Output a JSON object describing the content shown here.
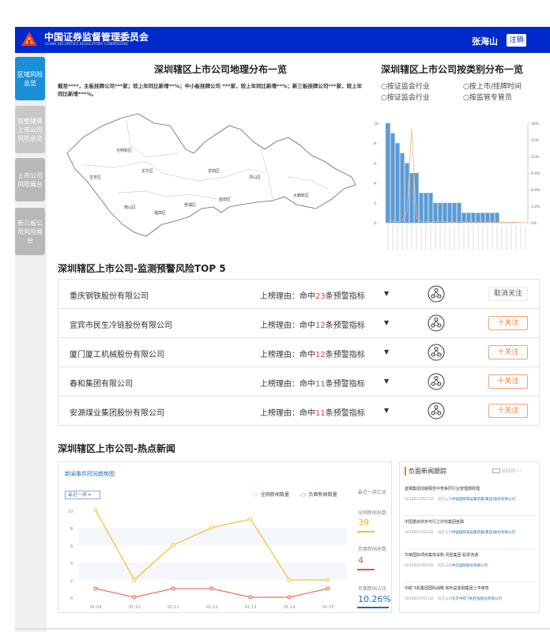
{
  "header": {
    "org_cn": "中国证券监督管理委员会",
    "org_en": "CHINA SECURITIES REGULATORY COMMISSION",
    "username": "张海山",
    "logout": "注销"
  },
  "sidebar": {
    "items": [
      {
        "label": "区域风险总览",
        "active": true
      },
      {
        "label": "监管辖属上市公司风险总览",
        "active": false
      },
      {
        "label": "上市公司风险展台",
        "active": false
      },
      {
        "label": "新三板公司风险展台",
        "active": false
      }
    ]
  },
  "geo": {
    "title": "深圳辖区上市公司地理分布一览",
    "note": "截至****，主板挂牌公司***家；较上年同比新增**%；中小板挂牌公司 ***家，较上年同比新增**%；新三板挂牌公司***家，较上年同比新增***%。",
    "districts": [
      "光明新区",
      "宝安区",
      "龙华区",
      "龙岗区",
      "坪山区",
      "大鹏新区",
      "南山区",
      "福田区",
      "罗湖区",
      "盐田区"
    ]
  },
  "category": {
    "title": "深圳辖区上市公司按类别分布一览",
    "options": [
      "按证监会行业",
      "按上市/挂牌时间",
      "按证监会行业",
      "按监管专管员"
    ]
  },
  "chart_data": {
    "type": "bar",
    "bar_values": [
      10,
      9,
      8,
      7,
      6,
      5,
      5,
      3,
      3,
      3,
      2,
      2,
      2,
      2,
      2,
      2,
      1,
      1,
      1,
      1,
      1,
      1,
      1,
      1,
      0,
      0,
      0,
      0,
      0,
      0
    ],
    "line_values": [
      0.5,
      0.3,
      0.2,
      0.5,
      2,
      17,
      0.8,
      0.3,
      0.2,
      0.1,
      0.2,
      0.3,
      0.2,
      0.1,
      0.1,
      0.2,
      0.1,
      0.1,
      0.1,
      0.1,
      0.1,
      0.1,
      0.1,
      0.1,
      0.1,
      0.1,
      0.1,
      0.1,
      0,
      0
    ],
    "ylim_left": [
      0,
      10
    ],
    "ylim_right": [
      0,
      18
    ],
    "yticks_left": [
      "10 -",
      "8 -",
      "6 -",
      "4 -",
      "2 -",
      "0 -"
    ],
    "yticks_right": [
      "- 18%",
      "- 15%",
      "- 12%",
      "- 9.0%",
      "- 6.0%",
      "- 3.0%",
      "- 0%"
    ],
    "bar_color": "#5b9bd5",
    "line_color": "#f4b183"
  },
  "top5": {
    "title": "深圳辖区上市公司-监测预警风险TOP 5",
    "reason_prefix": "上榜理由：命中",
    "reason_suffix": "条预警指标",
    "rows": [
      {
        "name": "重庆钢铁股份有限公司",
        "count": "23",
        "action": "取消关注"
      },
      {
        "name": "宜宾市民生冷链股份有限公司",
        "count": "12",
        "action": "十关注"
      },
      {
        "name": "厦门厦工机械股份有限公司",
        "count": "12",
        "action": "十关注"
      },
      {
        "name": "春和集团有限公司",
        "count": "11",
        "action": "十关注"
      },
      {
        "name": "安源煤业集团股份有限公司",
        "count": "11",
        "action": "十关注"
      }
    ]
  },
  "news": {
    "title": "深圳辖区上市公司-热点新闻",
    "trend": {
      "title": "新闻事件时间趋势图",
      "select": "最近一周",
      "legend_all": "全网新闻数量",
      "legend_neg": "负面新闻数量",
      "stats_header": "最近一周汇总",
      "total_label": "全网新闻总数",
      "total_value": "39",
      "neg_label": "负面新闻总数",
      "neg_value": "4",
      "ratio_label": "负面新闻占比",
      "ratio_value": "10.26%"
    },
    "negative": {
      "title": "负面新闻跟踪",
      "page": "1/3122",
      "items": [
        {
          "title": "首钢集团前期报告中竞争同行业管理部经理",
          "date": "2018年01月15日",
          "source": "同方公司",
          "company": "中国国际海运集装箱(集团)股份有限公司"
        },
        {
          "title": "中国重启债务可行之外债集团金融",
          "date": "2018年01月15日",
          "source": "同方公司",
          "company": "中国国际海运集装箱(集团)股份有限公司"
        },
        {
          "title": "华荣国际项目集体采购 风险集团 股票流通",
          "date": "2018年01月15日",
          "source": "同方公司",
          "company": "中信国际股份有限公司"
        },
        {
          "title": "中航飞机集团国际战略 和利益金融集团上市审查",
          "date": "2018年01月15日",
          "source": "同方公司",
          "company": "北京中航飞机控股股份有限公司"
        }
      ]
    }
  }
}
